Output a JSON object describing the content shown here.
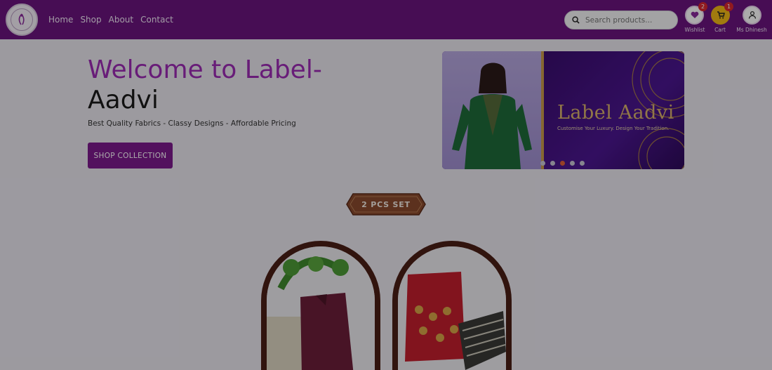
{
  "nav": {
    "items": [
      "Home",
      "Shop",
      "About",
      "Contact"
    ]
  },
  "search": {
    "placeholder": "Search products..."
  },
  "header_actions": {
    "wishlist_label": "Wishlist",
    "wishlist_count": "2",
    "cart_label": "Cart",
    "cart_count": "1",
    "account_label": "Ms Dhinesh"
  },
  "hero": {
    "title_accent": "Welcome to Label-",
    "title_plain": "Aadvi",
    "subtitle": "Best Quality Fabrics - Classy Designs - Affordable Pricing",
    "cta": "SHOP COLLECTION"
  },
  "banner": {
    "brand": "Label Aadvi",
    "tagline": "Customise Your Luxury. Design Your Tradition.",
    "slide_count": 5,
    "active_slide": 3
  },
  "section": {
    "title": "2 PCS SET"
  },
  "colors": {
    "header": "#6a147e",
    "accent": "#9b2bb3",
    "button": "#7c1a8c",
    "card_frame": "#4a1e16",
    "tag": "#8a4a2e"
  }
}
